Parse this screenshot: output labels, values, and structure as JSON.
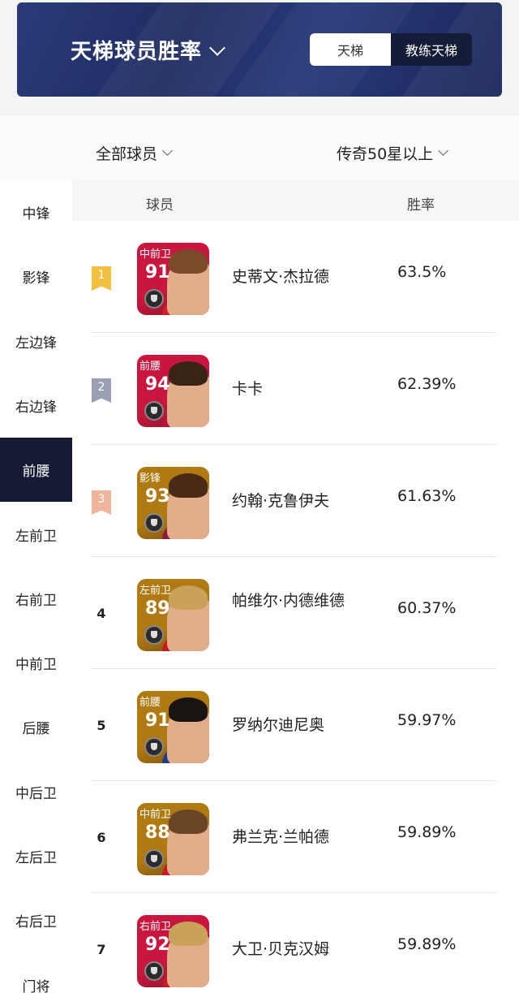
{
  "header": {
    "title": "天梯球员胜率",
    "tabs": [
      {
        "label": "天梯",
        "active": true
      },
      {
        "label": "教练天梯",
        "active": false
      }
    ]
  },
  "filters": {
    "player_filter": "全部球员",
    "tier_filter": "传奇50星以上"
  },
  "sidebar": {
    "items": [
      {
        "label": "中锋",
        "active": false
      },
      {
        "label": "影锋",
        "active": false
      },
      {
        "label": "左边锋",
        "active": false
      },
      {
        "label": "右边锋",
        "active": false
      },
      {
        "label": "前腰",
        "active": true
      },
      {
        "label": "左前卫",
        "active": false
      },
      {
        "label": "右前卫",
        "active": false
      },
      {
        "label": "中前卫",
        "active": false
      },
      {
        "label": "后腰",
        "active": false
      },
      {
        "label": "中后卫",
        "active": false
      },
      {
        "label": "左后卫",
        "active": false
      },
      {
        "label": "右后卫",
        "active": false
      },
      {
        "label": "门将",
        "active": false
      }
    ]
  },
  "table": {
    "columns": {
      "player": "球员",
      "win_rate": "胜率"
    },
    "rows": [
      {
        "rank": "1",
        "position": "中前卫",
        "rating": "91",
        "name": "史蒂文·杰拉德",
        "win_rate": "63.5%",
        "card_color": "#c8163f",
        "shirt_color": "#d21f2b",
        "hair_color": "#7a4a2a"
      },
      {
        "rank": "2",
        "position": "前腰",
        "rating": "94",
        "name": "卡卡",
        "win_rate": "62.39%",
        "card_color": "#c8163f",
        "shirt_color": "#b8123a",
        "hair_color": "#3a2416"
      },
      {
        "rank": "3",
        "position": "影锋",
        "rating": "93",
        "name": "约翰·克鲁伊夫",
        "win_rate": "61.63%",
        "card_color": "#b07a12",
        "shirt_color": "#8a1d3c",
        "hair_color": "#4a2a16"
      },
      {
        "rank": "4",
        "position": "左前卫",
        "rating": "89",
        "name": "帕维尔·内德维德",
        "win_rate": "60.37%",
        "card_color": "#b07a12",
        "shirt_color": "#c41b24",
        "hair_color": "#c9a15a"
      },
      {
        "rank": "5",
        "position": "前腰",
        "rating": "91",
        "name": "罗纳尔迪尼奥",
        "win_rate": "59.97%",
        "card_color": "#b07a12",
        "shirt_color": "#1f3d8f",
        "hair_color": "#1a1410"
      },
      {
        "rank": "6",
        "position": "中前卫",
        "rating": "88",
        "name": "弗兰克·兰帕德",
        "win_rate": "59.89%",
        "card_color": "#b07a12",
        "shirt_color": "#c41b24",
        "hair_color": "#6a4626"
      },
      {
        "rank": "7",
        "position": "右前卫",
        "rating": "92",
        "name": "大卫·贝克汉姆",
        "win_rate": "59.89%",
        "card_color": "#c8163f",
        "shirt_color": "#c41b24",
        "hair_color": "#c9a15a"
      }
    ]
  },
  "colors": {
    "rank_1": "#f3bf3f",
    "rank_2": "#9aa0b4",
    "rank_3": "#f0b49a",
    "skin": "#e2ad8a"
  }
}
